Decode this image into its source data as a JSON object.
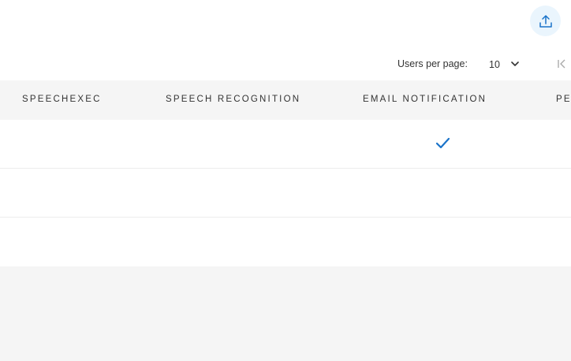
{
  "toolbar": {
    "upload_icon": "upload-icon"
  },
  "pagination": {
    "label": "Users per page:",
    "per_page": "10",
    "first_page_icon": "first-page-icon"
  },
  "table": {
    "columns": [
      "SPEECHEXEC",
      "SPEECH RECOGNITION",
      "EMAIL NOTIFICATION",
      "PER"
    ],
    "rows": [
      {
        "speechexec": false,
        "speech_recognition": false,
        "email_notification": true
      },
      {
        "speechexec": false,
        "speech_recognition": false,
        "email_notification": false
      },
      {
        "speechexec": false,
        "speech_recognition": false,
        "email_notification": false
      }
    ]
  },
  "colors": {
    "accent": "#1a73c9",
    "header_bg": "#f5f5f5",
    "upload_bg": "#eaf5fd"
  }
}
